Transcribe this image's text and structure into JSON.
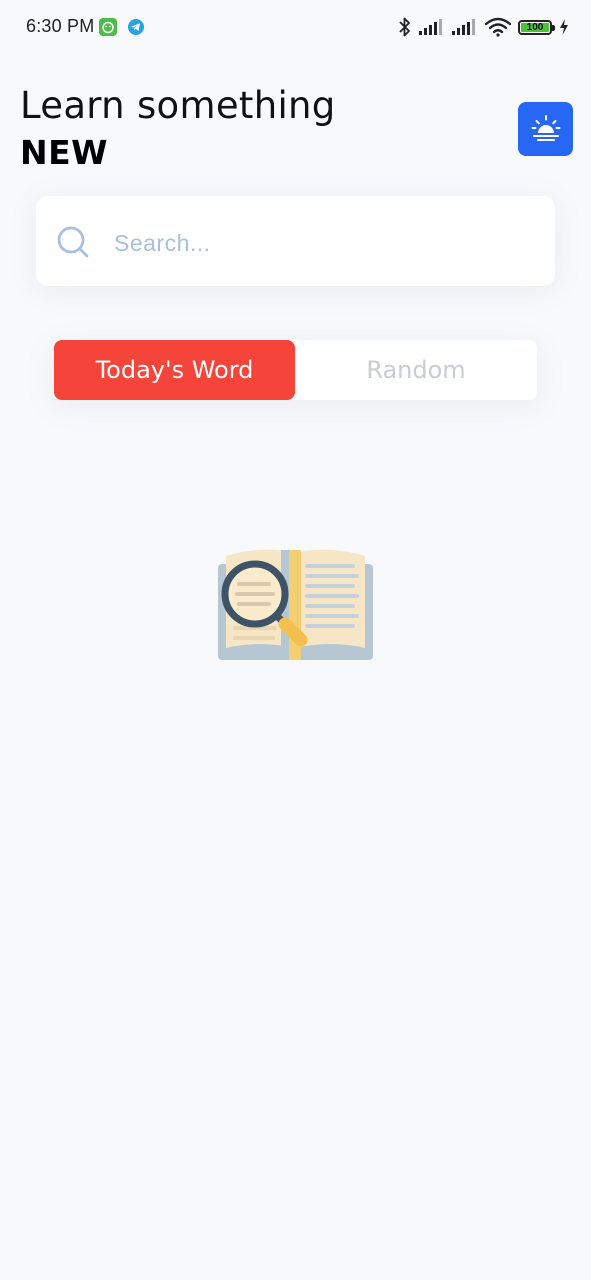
{
  "status_bar": {
    "time": "6:30 PM",
    "battery_level": "100",
    "icons": [
      "game-notification-icon",
      "telegram-icon",
      "bluetooth-icon",
      "signal-icon",
      "signal-icon",
      "wifi-icon",
      "battery-icon",
      "charging-icon"
    ]
  },
  "header": {
    "title_line1": "Learn something",
    "title_line2": "NEW",
    "theme_button_icon": "sunrise-icon"
  },
  "search": {
    "placeholder": "Search...",
    "value": ""
  },
  "tabs": {
    "items": [
      {
        "label": "Today's Word",
        "active": true
      },
      {
        "label": "Random",
        "active": false
      }
    ]
  },
  "empty_state": {
    "illustration": "open-book-magnifier-icon"
  },
  "colors": {
    "background": "#f7f9fb",
    "accent_blue": "#2667f5",
    "active_tab": "#f5443a",
    "inactive_tab_text": "#c9cdd3",
    "search_placeholder": "#a8bfdf"
  }
}
